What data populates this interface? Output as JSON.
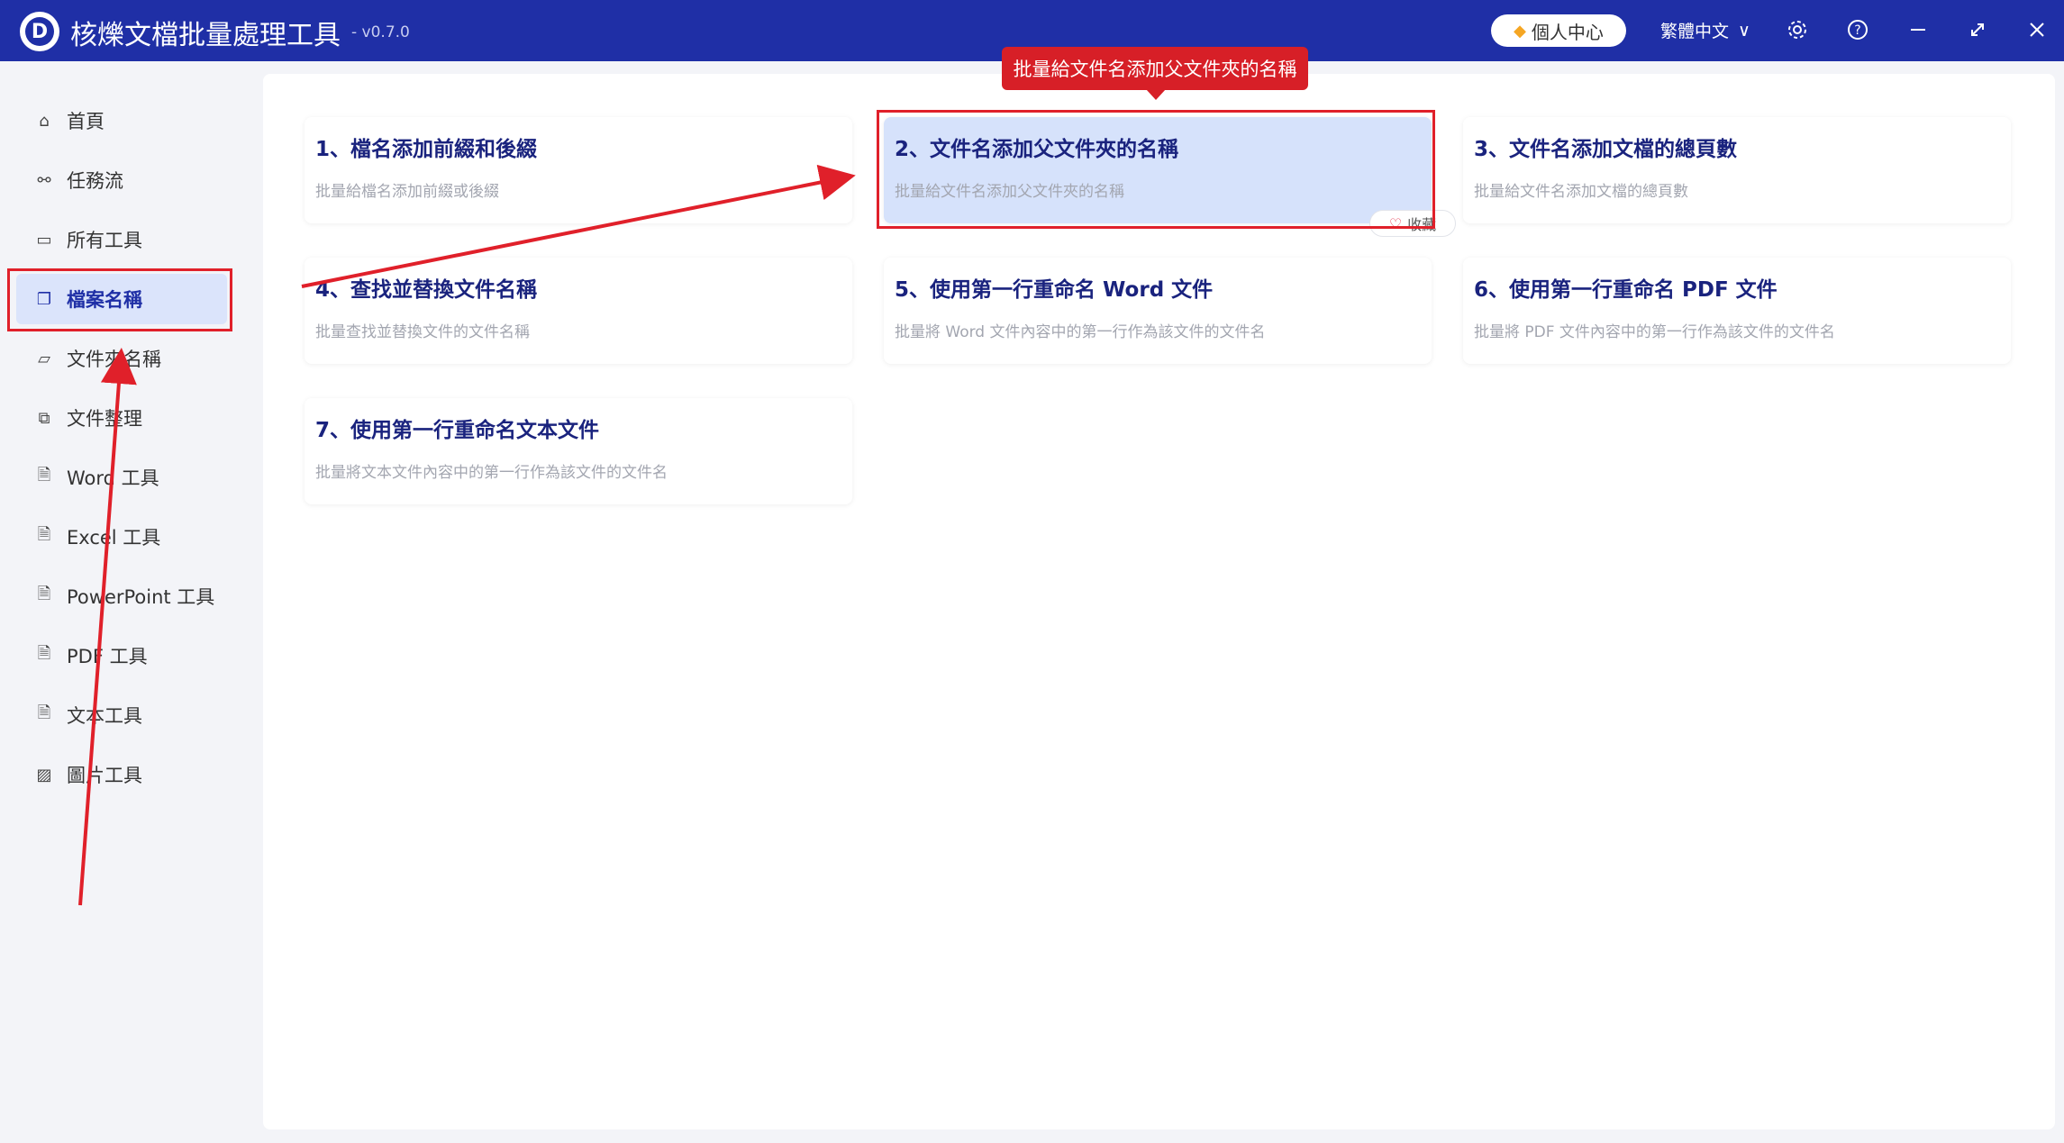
{
  "app": {
    "logo_letter": "D",
    "title": "核爍文檔批量處理工具",
    "version": "- v0.7.0",
    "profile_label": "個人中心",
    "language": "繁體中文",
    "language_chevron": "∨",
    "icons": {
      "settings": "⚙",
      "help": "?",
      "minimize": "—",
      "maximize": "⤢",
      "close": "✕"
    }
  },
  "sidebar": {
    "items": [
      {
        "label": "首頁",
        "icon": "home-icon"
      },
      {
        "label": "任務流",
        "icon": "workflow-icon"
      },
      {
        "label": "所有工具",
        "icon": "monitor-icon"
      },
      {
        "label": "檔案名稱",
        "icon": "file-name-icon"
      },
      {
        "label": "文件夾名稱",
        "icon": "folder-icon"
      },
      {
        "label": "文件整理",
        "icon": "organize-icon"
      },
      {
        "label": "Word 工具",
        "icon": "word-icon"
      },
      {
        "label": "Excel 工具",
        "icon": "excel-icon"
      },
      {
        "label": "PowerPoint 工具",
        "icon": "powerpoint-icon"
      },
      {
        "label": "PDF 工具",
        "icon": "pdf-icon"
      },
      {
        "label": "文本工具",
        "icon": "text-icon"
      },
      {
        "label": "圖片工具",
        "icon": "image-icon"
      }
    ],
    "active_index": 3
  },
  "cards": [
    {
      "title": "1、檔名添加前綴和後綴",
      "desc": "批量給檔名添加前綴或後綴"
    },
    {
      "title": "2、文件名添加父文件夾的名稱",
      "desc": "批量給文件名添加父文件夾的名稱"
    },
    {
      "title": "3、文件名添加文檔的總頁數",
      "desc": "批量給文件名添加文檔的總頁數"
    },
    {
      "title": "4、查找並替換文件名稱",
      "desc": "批量查找並替換文件的文件名稱"
    },
    {
      "title": "5、使用第一行重命名 Word 文件",
      "desc": "批量將 Word 文件內容中的第一行作為該文件的文件名"
    },
    {
      "title": "6、使用第一行重命名 PDF 文件",
      "desc": "批量將 PDF 文件內容中的第一行作為該文件的文件名"
    },
    {
      "title": "7、使用第一行重命名文本文件",
      "desc": "批量將文本文件內容中的第一行作為該文件的文件名"
    }
  ],
  "favorite_label": "收藏",
  "tooltip": "批量給文件名添加父文件夾的名稱",
  "colors": {
    "titlebar": "#1f2fa6",
    "accent": "#1a237e",
    "annotation_red": "#e0202a",
    "selected_card": "#d6e2fb",
    "active_sidebar": "#dbe4fb"
  }
}
